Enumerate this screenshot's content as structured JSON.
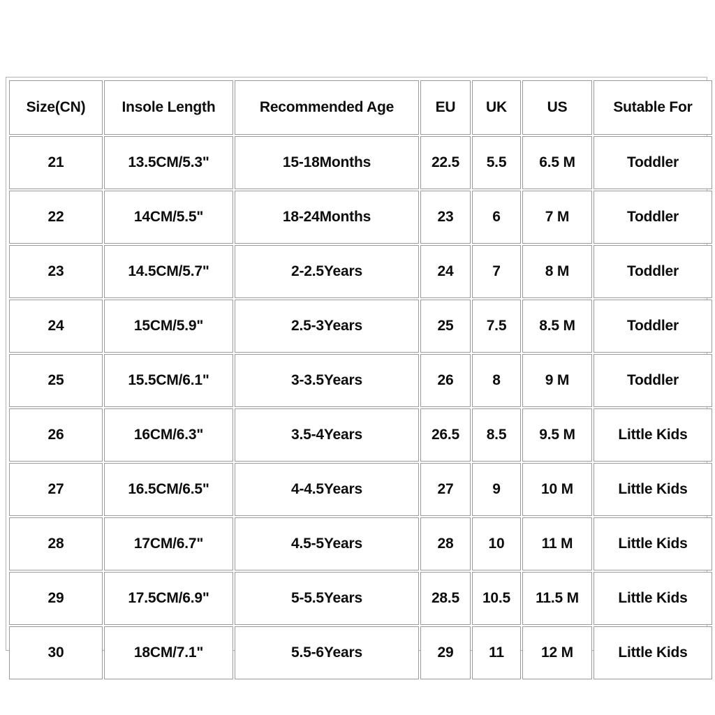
{
  "chart_data": {
    "type": "table",
    "title": "",
    "columns": [
      "Size(CN)",
      "Insole Length",
      "Recommended Age",
      "EU",
      "UK",
      "US",
      "Sutable For"
    ],
    "rows": [
      [
        "21",
        "13.5CM/5.3\"",
        "15-18Months",
        "22.5",
        "5.5",
        "6.5 M",
        "Toddler"
      ],
      [
        "22",
        "14CM/5.5\"",
        "18-24Months",
        "23",
        "6",
        "7 M",
        "Toddler"
      ],
      [
        "23",
        "14.5CM/5.7\"",
        "2-2.5Years",
        "24",
        "7",
        "8 M",
        "Toddler"
      ],
      [
        "24",
        "15CM/5.9\"",
        "2.5-3Years",
        "25",
        "7.5",
        "8.5 M",
        "Toddler"
      ],
      [
        "25",
        "15.5CM/6.1\"",
        "3-3.5Years",
        "26",
        "8",
        "9 M",
        "Toddler"
      ],
      [
        "26",
        "16CM/6.3\"",
        "3.5-4Years",
        "26.5",
        "8.5",
        "9.5 M",
        "Little Kids"
      ],
      [
        "27",
        "16.5CM/6.5\"",
        "4-4.5Years",
        "27",
        "9",
        "10 M",
        "Little Kids"
      ],
      [
        "28",
        "17CM/6.7\"",
        "4.5-5Years",
        "28",
        "10",
        "11 M",
        "Little Kids"
      ],
      [
        "29",
        "17.5CM/6.9\"",
        "5-5.5Years",
        "28.5",
        "10.5",
        "11.5 M",
        "Little Kids"
      ],
      [
        "30",
        "18CM/7.1\"",
        "5.5-6Years",
        "29",
        "11",
        "12 M",
        "Little Kids"
      ]
    ],
    "colors": {
      "background": "#ffffff",
      "cell_background": "#ffffff",
      "cell_border": "#9a9a9a",
      "frame_border": "#b4b4b4",
      "text": "#0d0d0d"
    }
  }
}
